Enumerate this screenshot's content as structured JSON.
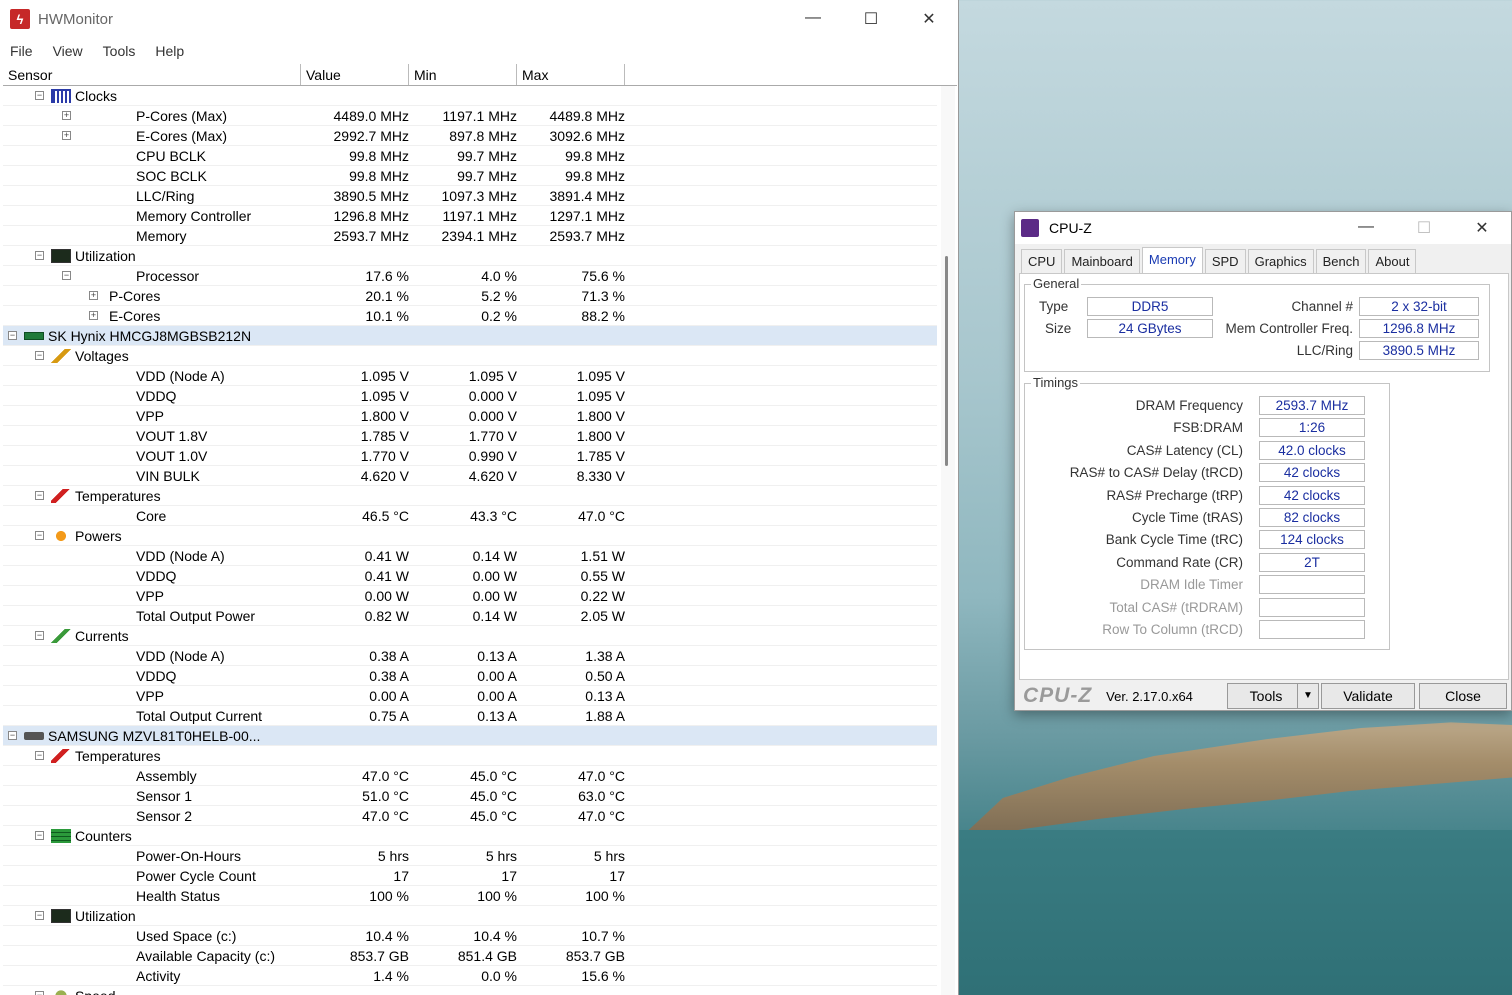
{
  "hwmonitor": {
    "title": "HWMonitor",
    "menu": [
      "File",
      "View",
      "Tools",
      "Help"
    ],
    "columns": [
      "Sensor",
      "Value",
      "Min",
      "Max"
    ],
    "rows": [
      {
        "indent": 2,
        "kind": "cat",
        "icon": "clock-icon",
        "exp": "minus",
        "name": "Clocks"
      },
      {
        "indent": 3,
        "exp": "plus",
        "name": "P-Cores (Max)",
        "value": "4489.0 MHz",
        "min": "1197.1 MHz",
        "max": "4489.8 MHz"
      },
      {
        "indent": 3,
        "exp": "plus",
        "name": "E-Cores (Max)",
        "value": "2992.7 MHz",
        "min": "897.8 MHz",
        "max": "3092.6 MHz"
      },
      {
        "indent": 3,
        "name": "CPU BCLK",
        "value": "99.8 MHz",
        "min": "99.7 MHz",
        "max": "99.8 MHz"
      },
      {
        "indent": 3,
        "name": "SOC BCLK",
        "value": "99.8 MHz",
        "min": "99.7 MHz",
        "max": "99.8 MHz"
      },
      {
        "indent": 3,
        "name": "LLC/Ring",
        "value": "3890.5 MHz",
        "min": "1097.3 MHz",
        "max": "3891.4 MHz"
      },
      {
        "indent": 3,
        "name": "Memory Controller",
        "value": "1296.8 MHz",
        "min": "1197.1 MHz",
        "max": "1297.1 MHz"
      },
      {
        "indent": 3,
        "name": "Memory",
        "value": "2593.7 MHz",
        "min": "2394.1 MHz",
        "max": "2593.7 MHz"
      },
      {
        "indent": 2,
        "kind": "cat",
        "icon": "utilization-icon",
        "exp": "minus",
        "name": "Utilization"
      },
      {
        "indent": 3,
        "exp": "minus",
        "name": "Processor",
        "value": "17.6 %",
        "min": "4.0 %",
        "max": "75.6 %"
      },
      {
        "indent": 4,
        "exp": "plus",
        "name": "P-Cores",
        "value": "20.1 %",
        "min": "5.2 %",
        "max": "71.3 %"
      },
      {
        "indent": 4,
        "exp": "plus",
        "name": "E-Cores",
        "value": "10.1 %",
        "min": "0.2 %",
        "max": "88.2 %"
      },
      {
        "indent": 1,
        "kind": "dev",
        "icon": "memory-module-icon",
        "exp": "minus",
        "name": "SK Hynix HMCGJ8MGBSB212N"
      },
      {
        "indent": 2,
        "kind": "cat",
        "icon": "voltage-icon",
        "exp": "minus",
        "name": "Voltages"
      },
      {
        "indent": 3,
        "name": "VDD (Node A)",
        "value": "1.095 V",
        "min": "1.095 V",
        "max": "1.095 V"
      },
      {
        "indent": 3,
        "name": "VDDQ",
        "value": "1.095 V",
        "min": "0.000 V",
        "max": "1.095 V"
      },
      {
        "indent": 3,
        "name": "VPP",
        "value": "1.800 V",
        "min": "0.000 V",
        "max": "1.800 V"
      },
      {
        "indent": 3,
        "name": "VOUT 1.8V",
        "value": "1.785 V",
        "min": "1.770 V",
        "max": "1.800 V"
      },
      {
        "indent": 3,
        "name": "VOUT 1.0V",
        "value": "1.770 V",
        "min": "0.990 V",
        "max": "1.785 V"
      },
      {
        "indent": 3,
        "name": "VIN BULK",
        "value": "4.620 V",
        "min": "4.620 V",
        "max": "8.330 V"
      },
      {
        "indent": 2,
        "kind": "cat",
        "icon": "thermometer-icon",
        "exp": "minus",
        "name": "Temperatures"
      },
      {
        "indent": 3,
        "name": "Core",
        "value": "46.5 °C",
        "min": "43.3 °C",
        "max": "47.0 °C"
      },
      {
        "indent": 2,
        "kind": "cat",
        "icon": "flame-icon",
        "exp": "minus",
        "name": "Powers"
      },
      {
        "indent": 3,
        "name": "VDD (Node A)",
        "value": "0.41 W",
        "min": "0.14 W",
        "max": "1.51 W"
      },
      {
        "indent": 3,
        "name": "VDDQ",
        "value": "0.41 W",
        "min": "0.00 W",
        "max": "0.55 W"
      },
      {
        "indent": 3,
        "name": "VPP",
        "value": "0.00 W",
        "min": "0.00 W",
        "max": "0.22 W"
      },
      {
        "indent": 3,
        "name": "Total Output Power",
        "value": "0.82 W",
        "min": "0.14 W",
        "max": "2.05 W"
      },
      {
        "indent": 2,
        "kind": "cat",
        "icon": "current-icon",
        "exp": "minus",
        "name": "Currents"
      },
      {
        "indent": 3,
        "name": "VDD (Node A)",
        "value": "0.38 A",
        "min": "0.13 A",
        "max": "1.38 A"
      },
      {
        "indent": 3,
        "name": "VDDQ",
        "value": "0.38 A",
        "min": "0.00 A",
        "max": "0.50 A"
      },
      {
        "indent": 3,
        "name": "VPP",
        "value": "0.00 A",
        "min": "0.00 A",
        "max": "0.13 A"
      },
      {
        "indent": 3,
        "name": "Total Output Current",
        "value": "0.75 A",
        "min": "0.13 A",
        "max": "1.88 A"
      },
      {
        "indent": 1,
        "kind": "dev",
        "icon": "drive-icon",
        "exp": "minus",
        "name": "SAMSUNG MZVL81T0HELB-00..."
      },
      {
        "indent": 2,
        "kind": "cat",
        "icon": "thermometer-icon",
        "exp": "minus",
        "name": "Temperatures"
      },
      {
        "indent": 3,
        "name": "Assembly",
        "value": "47.0 °C",
        "min": "45.0 °C",
        "max": "47.0 °C"
      },
      {
        "indent": 3,
        "name": "Sensor 1",
        "value": "51.0 °C",
        "min": "45.0 °C",
        "max": "63.0 °C"
      },
      {
        "indent": 3,
        "name": "Sensor 2",
        "value": "47.0 °C",
        "min": "45.0 °C",
        "max": "47.0 °C"
      },
      {
        "indent": 2,
        "kind": "cat",
        "icon": "counter-icon",
        "exp": "minus",
        "name": "Counters"
      },
      {
        "indent": 3,
        "name": "Power-On-Hours",
        "value": "5 hrs",
        "min": "5 hrs",
        "max": "5 hrs"
      },
      {
        "indent": 3,
        "name": "Power Cycle Count",
        "value": "17",
        "min": "17",
        "max": "17"
      },
      {
        "indent": 3,
        "name": "Health Status",
        "value": "100 %",
        "min": "100 %",
        "max": "100 %"
      },
      {
        "indent": 2,
        "kind": "cat",
        "icon": "utilization-icon",
        "exp": "minus",
        "name": "Utilization"
      },
      {
        "indent": 3,
        "name": "Used Space (c:)",
        "value": "10.4 %",
        "min": "10.4 %",
        "max": "10.7 %"
      },
      {
        "indent": 3,
        "name": "Available Capacity (c:)",
        "value": "853.7 GB",
        "min": "851.4 GB",
        "max": "853.7 GB"
      },
      {
        "indent": 3,
        "name": "Activity",
        "value": "1.4 %",
        "min": "0.0 %",
        "max": "15.6 %"
      },
      {
        "indent": 2,
        "kind": "cat",
        "icon": "speed-icon",
        "exp": "minus",
        "name": "Speed"
      }
    ]
  },
  "cpuz": {
    "title": "CPU-Z",
    "tabs": [
      "CPU",
      "Mainboard",
      "Memory",
      "SPD",
      "Graphics",
      "Bench",
      "About"
    ],
    "active_tab": "Memory",
    "general": {
      "label": "General",
      "type_label": "Type",
      "type": "DDR5",
      "size_label": "Size",
      "size": "24 GBytes",
      "channel_label": "Channel #",
      "channel": "2 x 32-bit",
      "mcf_label": "Mem Controller Freq.",
      "mcf": "1296.8 MHz",
      "llc_label": "LLC/Ring",
      "llc": "3890.5 MHz"
    },
    "timings": {
      "label": "Timings",
      "items": [
        {
          "label": "DRAM Frequency",
          "value": "2593.7 MHz",
          "disabled": false
        },
        {
          "label": "FSB:DRAM",
          "value": "1:26",
          "disabled": false
        },
        {
          "label": "CAS# Latency (CL)",
          "value": "42.0 clocks",
          "disabled": false
        },
        {
          "label": "RAS# to CAS# Delay (tRCD)",
          "value": "42 clocks",
          "disabled": false
        },
        {
          "label": "RAS# Precharge (tRP)",
          "value": "42 clocks",
          "disabled": false
        },
        {
          "label": "Cycle Time (tRAS)",
          "value": "82 clocks",
          "disabled": false
        },
        {
          "label": "Bank Cycle Time (tRC)",
          "value": "124 clocks",
          "disabled": false
        },
        {
          "label": "Command Rate (CR)",
          "value": "2T",
          "disabled": false
        },
        {
          "label": "DRAM Idle Timer",
          "value": "",
          "disabled": true
        },
        {
          "label": "Total CAS# (tRDRAM)",
          "value": "",
          "disabled": true
        },
        {
          "label": "Row To Column (tRCD)",
          "value": "",
          "disabled": true
        }
      ]
    },
    "footer": {
      "logo": "CPU-Z",
      "version": "Ver. 2.17.0.x64",
      "tools": "Tools",
      "validate": "Validate",
      "close": "Close"
    }
  }
}
